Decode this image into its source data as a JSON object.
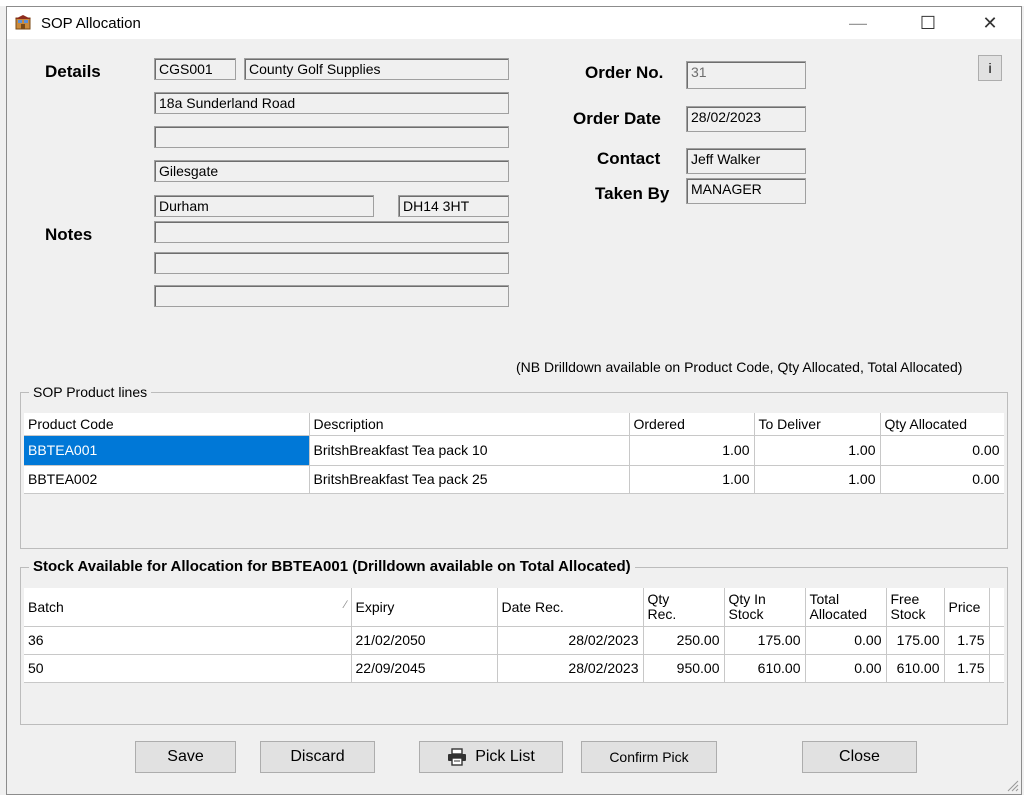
{
  "window": {
    "title": "SOP Allocation",
    "minimize_glyph": "—",
    "maximize_glyph": "☐",
    "close_glyph": "✕"
  },
  "labels": {
    "details": "Details",
    "notes": "Notes",
    "order_no": "Order No.",
    "order_date": "Order Date",
    "contact": "Contact",
    "taken_by": "Taken By"
  },
  "customer": {
    "code": "CGS001",
    "name": "County Golf Supplies",
    "address1": "18a Sunderland Road",
    "address2": "",
    "address3": "Gilesgate",
    "town": "Durham",
    "postcode": "DH14 3HT",
    "notes1": "",
    "notes2": "",
    "notes3": ""
  },
  "order": {
    "number": "31",
    "date": "28/02/2023",
    "contact": "Jeff Walker",
    "taken_by": "MANAGER"
  },
  "info_button": "i",
  "nb_note": "(NB Drilldown available on Product Code, Qty Allocated, Total Allocated)",
  "product_lines": {
    "title": "SOP Product lines",
    "columns": [
      "Product Code",
      "Description",
      "Ordered",
      "To Deliver",
      "Qty Allocated"
    ],
    "rows": [
      [
        "BBTEA001",
        "BritshBreakfast  Tea pack 10",
        "1.00",
        "1.00",
        "0.00"
      ],
      [
        "BBTEA002",
        "BritshBreakfast  Tea pack 25",
        "1.00",
        "1.00",
        "0.00"
      ]
    ]
  },
  "stock": {
    "title": "Stock Available for Allocation for BBTEA001 (Drilldown available on Total Allocated)",
    "columns": [
      "Batch",
      "Expiry",
      "Date Rec.",
      "Qty\nRec.",
      "Qty In\nStock",
      "Total\nAllocated",
      "Free\nStock",
      "Price"
    ],
    "rows": [
      [
        "36",
        "21/02/2050",
        "28/02/2023",
        "250.00",
        "175.00",
        "0.00",
        "175.00",
        "1.75"
      ],
      [
        "50",
        "22/09/2045",
        "28/02/2023",
        "950.00",
        "610.00",
        "0.00",
        "610.00",
        "1.75"
      ]
    ]
  },
  "buttons": {
    "save": "Save",
    "discard": "Discard",
    "pick_list": "Pick List",
    "confirm_pick": "Confirm Pick",
    "close": "Close"
  },
  "colors": {
    "selection": "#0078d7",
    "window_bg": "#f0f0f0"
  }
}
